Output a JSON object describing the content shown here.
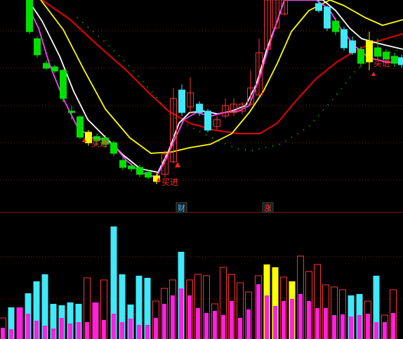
{
  "chart_data": {
    "type": "candlestick",
    "subtype": "stock-kline-with-volume",
    "grid": true,
    "colors": {
      "background": "#000000",
      "grid": "#8a1a1a",
      "up_candle": "#ff3232",
      "down_candle": "#00e000",
      "cyan_candle": "#40e8f8",
      "ma_white": "#ffffff",
      "ma_magenta": "#ff40ff",
      "ma_yellow": "#ffff00",
      "ma_red": "#e80000",
      "dotted_green": "#00cc00",
      "volume_cyan": "#40e8f8",
      "volume_magenta": "#ff20e0",
      "volume_yellow": "#ffff00",
      "volume_hollow": "#ff3232",
      "signal_text": "#ff3030",
      "signal_arrow": "#ff2020",
      "event_icon_bg": "#1a1a1a"
    },
    "signals": [
      {
        "label": "买进",
        "type": "buy"
      },
      {
        "label": "买进",
        "type": "buy"
      },
      {
        "label": "买进",
        "type": "buy"
      }
    ],
    "event_markers": [
      {
        "label": "财",
        "color": "#40c8ff"
      },
      {
        "label": "涨",
        "color": "#ff4040"
      }
    ]
  }
}
